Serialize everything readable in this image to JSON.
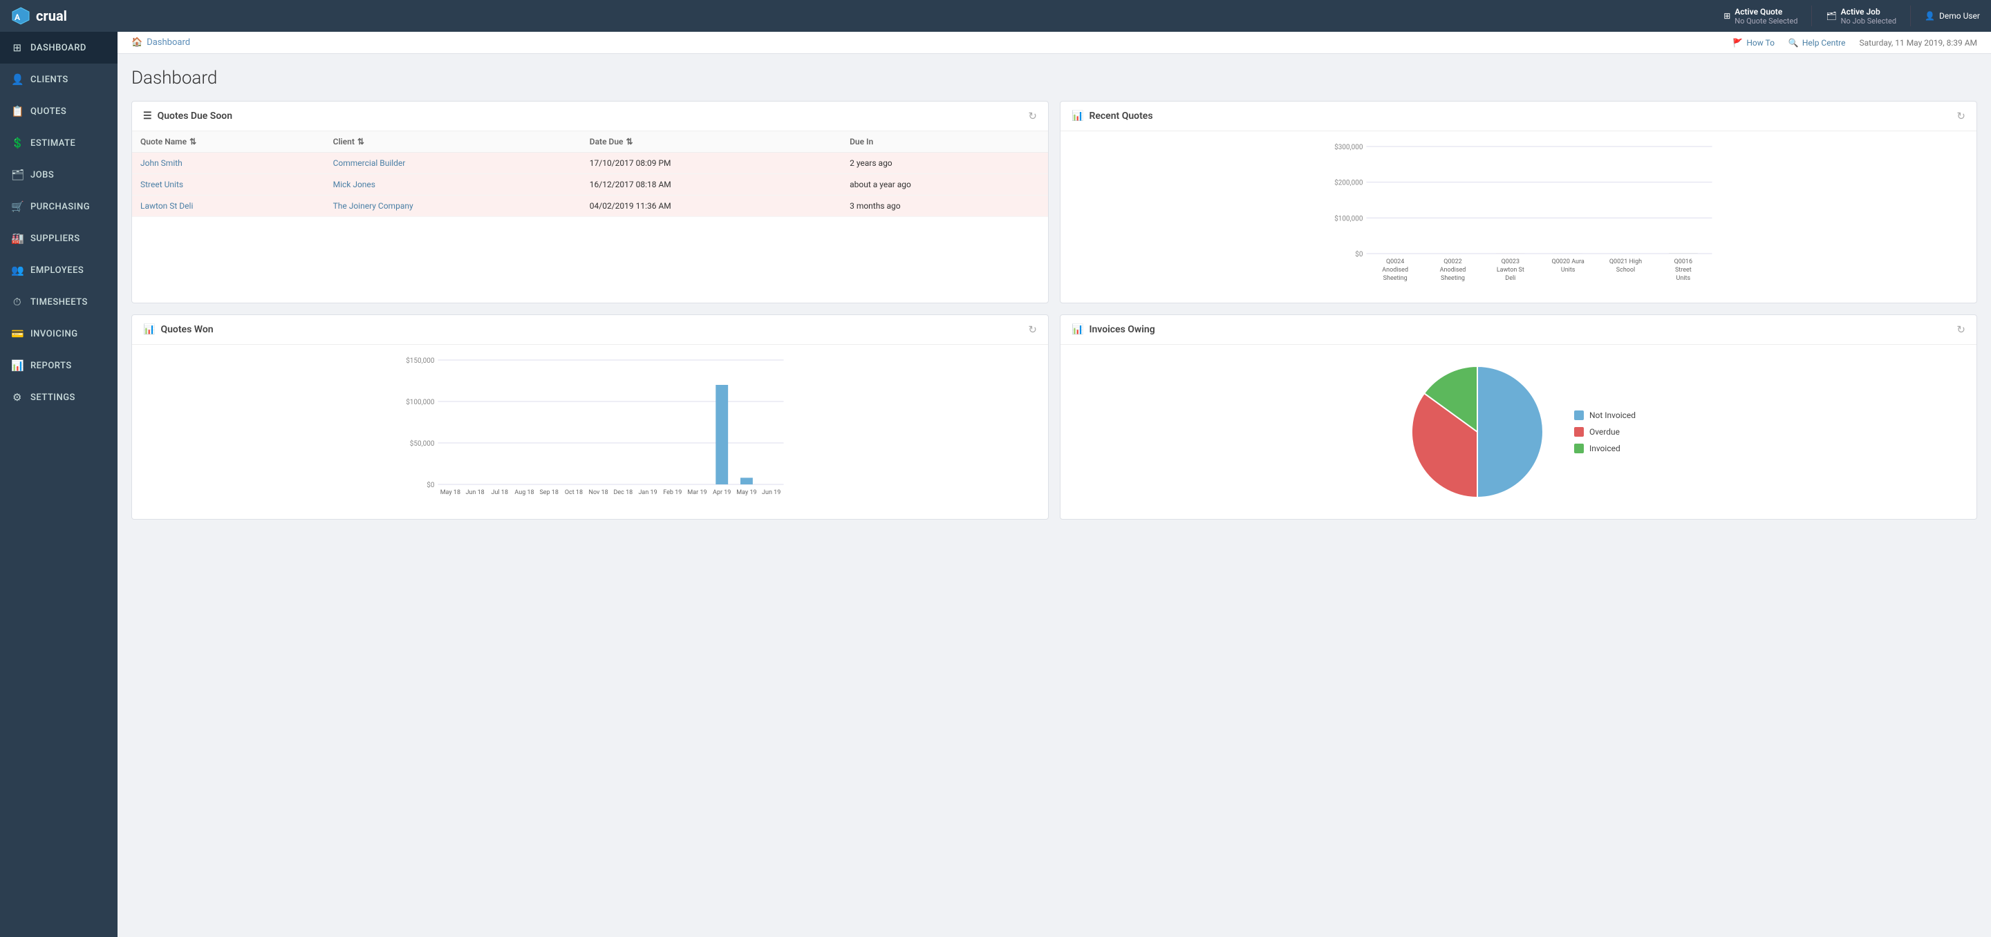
{
  "app": {
    "logo_text": "crual",
    "active_quote_label": "Active Quote",
    "active_quote_value": "No Quote Selected",
    "active_job_label": "Active Job",
    "active_job_value": "No Job Selected",
    "user_label": "Demo User"
  },
  "breadcrumb": {
    "home": "Dashboard",
    "how_to": "How To",
    "help_centre": "Help Centre",
    "datetime": "Saturday, 11 May 2019, 8:39 AM"
  },
  "sidebar": {
    "items": [
      {
        "id": "dashboard",
        "label": "DASHBOARD",
        "icon": "⊞"
      },
      {
        "id": "clients",
        "label": "CLIENTS",
        "icon": "👤"
      },
      {
        "id": "quotes",
        "label": "QUOTES",
        "icon": "📋"
      },
      {
        "id": "estimate",
        "label": "ESTIMATE",
        "icon": "💲"
      },
      {
        "id": "jobs",
        "label": "JOBS",
        "icon": "🗂"
      },
      {
        "id": "purchasing",
        "label": "PURCHASING",
        "icon": "🛒"
      },
      {
        "id": "suppliers",
        "label": "SUPPLIERS",
        "icon": "🏭"
      },
      {
        "id": "employees",
        "label": "EMPLOYEES",
        "icon": "👥"
      },
      {
        "id": "timesheets",
        "label": "TIMESHEETS",
        "icon": "⏱"
      },
      {
        "id": "invoicing",
        "label": "INVOICING",
        "icon": "💳"
      },
      {
        "id": "reports",
        "label": "REPORTS",
        "icon": "📊"
      },
      {
        "id": "settings",
        "label": "SETTINGS",
        "icon": "⚙"
      }
    ]
  },
  "page": {
    "title": "Dashboard"
  },
  "quotes_due": {
    "card_title": "Quotes Due Soon",
    "columns": [
      "Quote Name",
      "Client",
      "Date Due",
      "Due In"
    ],
    "rows": [
      {
        "name": "John Smith",
        "client": "Commercial Builder",
        "date_due": "17/10/2017 08:09 PM",
        "due_in": "2 years ago",
        "overdue": true
      },
      {
        "name": "Street Units",
        "client": "Mick Jones",
        "date_due": "16/12/2017 08:18 AM",
        "due_in": "about a year ago",
        "overdue": true
      },
      {
        "name": "Lawton St Deli",
        "client": "The Joinery Company",
        "date_due": "04/02/2019 11:36 AM",
        "due_in": "3 months ago",
        "overdue": true
      }
    ]
  },
  "recent_quotes": {
    "card_title": "Recent Quotes",
    "y_labels": [
      "$0",
      "$100,000",
      "$200,000",
      "$300,000"
    ],
    "bars": [
      {
        "id": "Q0024",
        "label": "Q0024\nAnodised\nSheeting",
        "not_invoiced": 5,
        "overdue": 0,
        "invoiced": 0,
        "total": 5
      },
      {
        "id": "Q0022",
        "label": "Q0022\nAnodised\nSheeting",
        "not_invoiced": 8,
        "overdue": 0,
        "invoiced": 0,
        "total": 8
      },
      {
        "id": "Q0023",
        "label": "Q0023\nLawton St\nDeli",
        "not_invoiced": 45,
        "overdue": 55,
        "invoiced": 5,
        "total": 105
      },
      {
        "id": "Q0020",
        "label": "Q0020 Aura\nUnits",
        "not_invoiced": 60,
        "overdue": 30,
        "invoiced": 10,
        "total": 100
      },
      {
        "id": "Q0021",
        "label": "Q0021 High\nSchool",
        "not_invoiced": 25,
        "overdue": 0,
        "invoiced": 0,
        "total": 25
      },
      {
        "id": "Q0016",
        "label": "Q0016\nStreet\nUnits",
        "not_invoiced": 110,
        "overdue": 80,
        "invoiced": 85,
        "total": 275
      }
    ],
    "colors": {
      "not_invoiced": "#6baed6",
      "overdue": "#e05c5c",
      "invoiced": "#5cb85c"
    }
  },
  "quotes_won": {
    "card_title": "Quotes Won",
    "y_labels": [
      "$0",
      "$50,000",
      "$100,000",
      "$150,000"
    ],
    "x_labels": [
      "May 18",
      "Jun 18",
      "Jul 18",
      "Aug 18",
      "Sep 18",
      "Oct 18",
      "Nov 18",
      "Dec 18",
      "Jan 19",
      "Feb 19",
      "Mar 19",
      "Apr 19",
      "May 19",
      "Jun 19"
    ],
    "bars": [
      0,
      0,
      0,
      0,
      0,
      0,
      0,
      0,
      0,
      0,
      0,
      120000,
      8000,
      0
    ],
    "color": "#6baed6"
  },
  "invoices_owing": {
    "card_title": "Invoices Owing",
    "legend": [
      {
        "label": "Not Invoiced",
        "color": "#6baed6"
      },
      {
        "label": "Overdue",
        "color": "#e05c5c"
      },
      {
        "label": "Invoiced",
        "color": "#5cb85c"
      }
    ],
    "segments": [
      {
        "label": "Not Invoiced",
        "value": 50,
        "color": "#6baed6"
      },
      {
        "label": "Overdue",
        "value": 35,
        "color": "#e05c5c"
      },
      {
        "label": "Invoiced",
        "value": 15,
        "color": "#5cb85c"
      }
    ]
  }
}
